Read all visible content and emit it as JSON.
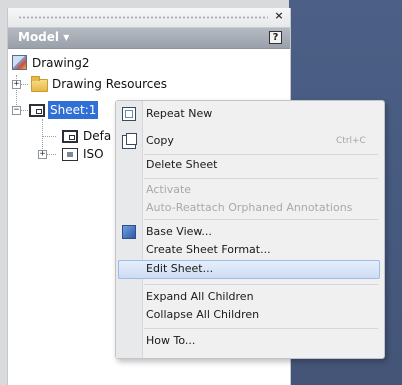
{
  "panel": {
    "title": "Model",
    "title_dropdown_glyph": "▾",
    "close_glyph": "×",
    "help_glyph": "?"
  },
  "tree": {
    "root_label": "Drawing2",
    "resources_label": "Drawing Resources",
    "sheet_label": "Sheet:1",
    "child1_label": "Defa",
    "child2_label": "ISO",
    "expand_glyph": "+",
    "collapse_glyph": "−"
  },
  "menu": {
    "items": [
      {
        "label": "Repeat New",
        "icon": "repeat-new-icon",
        "enabled": true
      },
      {
        "label": "Copy",
        "shortcut": "Ctrl+C",
        "icon": "copy-icon",
        "enabled": true
      },
      {
        "label": "Delete Sheet",
        "enabled": true
      },
      {
        "label": "Activate",
        "enabled": false
      },
      {
        "label": "Auto-Reattach Orphaned Annotations",
        "enabled": false
      },
      {
        "label": "Base View...",
        "icon": "base-view-icon",
        "enabled": true
      },
      {
        "label": "Create Sheet Format...",
        "enabled": true
      },
      {
        "label": "Edit Sheet...",
        "enabled": true,
        "highlighted": true
      },
      {
        "label": "Expand All Children",
        "enabled": true
      },
      {
        "label": "Collapse All Children",
        "enabled": true
      },
      {
        "label": "How To...",
        "enabled": true
      }
    ]
  },
  "colors": {
    "selection": "#2f6fd6",
    "canvas": "#4c5f86",
    "menu_background": "#f0f0f0"
  }
}
